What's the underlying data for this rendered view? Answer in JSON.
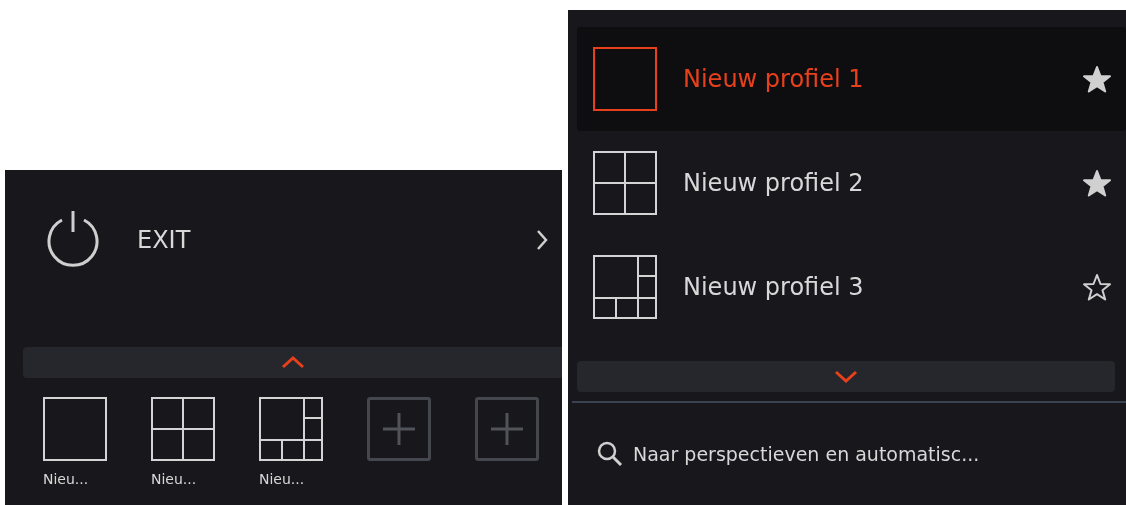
{
  "left_panel": {
    "exit_item": {
      "label": "EXIT"
    },
    "toggle_bar": {
      "kind": "up"
    },
    "layouts": [
      {
        "kind": "single",
        "label": "Nieu..."
      },
      {
        "kind": "quad",
        "label": "Nieu..."
      },
      {
        "kind": "mixed",
        "label": "Nieu..."
      },
      {
        "kind": "add"
      },
      {
        "kind": "add"
      }
    ]
  },
  "right_panel": {
    "profiles": [
      {
        "name": "Nieuw profiel 1",
        "kind": "single",
        "selected": true,
        "favorite": true
      },
      {
        "name": "Nieuw profiel 2",
        "kind": "quad",
        "selected": false,
        "favorite": true
      },
      {
        "name": "Nieuw profiel 3",
        "kind": "mixed",
        "selected": false,
        "favorite": false
      }
    ],
    "toggle_bar": {
      "kind": "down"
    },
    "search": {
      "placeholder": "Naar perspectieven en automatisc..."
    }
  }
}
